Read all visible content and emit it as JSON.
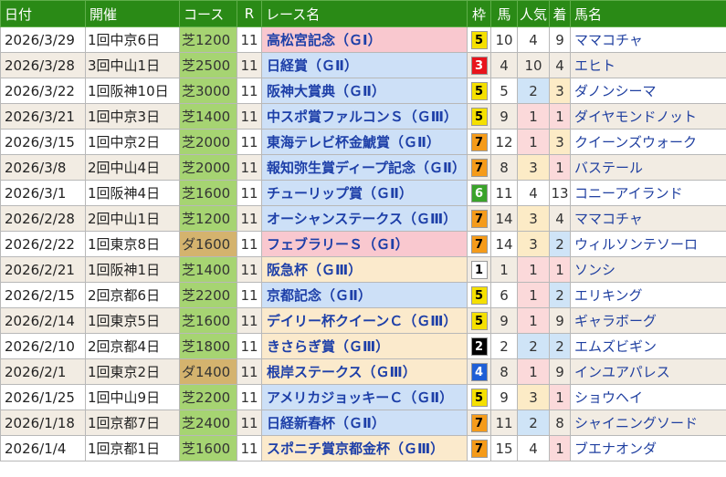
{
  "headers": [
    "日付",
    "開催",
    "コース",
    "R",
    "レース名",
    "枠",
    "馬",
    "人気",
    "着",
    "馬名"
  ],
  "frame_colors": {
    "1": {
      "bg": "#ffffff",
      "fg": "#000000"
    },
    "2": {
      "bg": "#000000",
      "fg": "#ffffff"
    },
    "3": {
      "bg": "#e8141c",
      "fg": "#ffffff"
    },
    "4": {
      "bg": "#1f5fd6",
      "fg": "#ffffff"
    },
    "5": {
      "bg": "#f5e000",
      "fg": "#000000"
    },
    "6": {
      "bg": "#3aa32a",
      "fg": "#ffffff"
    },
    "7": {
      "bg": "#f59b1a",
      "fg": "#000000"
    },
    "8": {
      "bg": "#f49ab5",
      "fg": "#000000"
    }
  },
  "rows": [
    {
      "date": "2026/3/29",
      "track": "1回中京6日",
      "surface": "turf",
      "course": "芝1200",
      "r": "11",
      "race": "高松宮記念（ＧⅠ）",
      "grade": "g1",
      "frame": "5",
      "horse_no": "10",
      "pop": "4",
      "finish": "9",
      "horse": "ママコチャ"
    },
    {
      "date": "2026/3/28",
      "track": "3回中山1日",
      "surface": "turf",
      "course": "芝2500",
      "r": "11",
      "race": "日経賞（ＧⅡ）",
      "grade": "g2",
      "frame": "3",
      "horse_no": "4",
      "pop": "10",
      "finish": "4",
      "horse": "エヒト"
    },
    {
      "date": "2026/3/22",
      "track": "1回阪神10日",
      "surface": "turf",
      "course": "芝3000",
      "r": "11",
      "race": "阪神大賞典（ＧⅡ）",
      "grade": "g2",
      "frame": "5",
      "horse_no": "5",
      "pop": "2",
      "finish": "3",
      "horse": "ダノンシーマ"
    },
    {
      "date": "2026/3/21",
      "track": "1回中京3日",
      "surface": "turf",
      "course": "芝1400",
      "r": "11",
      "race": "中スポ賞ファルコンＳ（ＧⅢ）",
      "grade": "g2",
      "frame": "5",
      "horse_no": "9",
      "pop": "1",
      "finish": "1",
      "horse": "ダイヤモンドノット"
    },
    {
      "date": "2026/3/15",
      "track": "1回中京2日",
      "surface": "turf",
      "course": "芝2000",
      "r": "11",
      "race": "東海テレビ杯金鯱賞（ＧⅡ）",
      "grade": "g2",
      "frame": "7",
      "horse_no": "12",
      "pop": "1",
      "finish": "3",
      "horse": "クイーンズウォーク"
    },
    {
      "date": "2026/3/8",
      "track": "2回中山4日",
      "surface": "turf",
      "course": "芝2000",
      "r": "11",
      "race": "報知弥生賞ディープ記念（ＧⅡ）",
      "grade": "g2",
      "frame": "7",
      "horse_no": "8",
      "pop": "3",
      "finish": "1",
      "horse": "バステール"
    },
    {
      "date": "2026/3/1",
      "track": "1回阪神4日",
      "surface": "turf",
      "course": "芝1600",
      "r": "11",
      "race": "チューリップ賞（ＧⅡ）",
      "grade": "g2",
      "frame": "6",
      "horse_no": "11",
      "pop": "4",
      "finish": "13",
      "horse": "コニーアイランド"
    },
    {
      "date": "2026/2/28",
      "track": "2回中山1日",
      "surface": "turf",
      "course": "芝1200",
      "r": "11",
      "race": "オーシャンステークス（ＧⅢ）",
      "grade": "g2",
      "frame": "7",
      "horse_no": "14",
      "pop": "3",
      "finish": "4",
      "horse": "ママコチャ"
    },
    {
      "date": "2026/2/22",
      "track": "1回東京8日",
      "surface": "dirt",
      "course": "ダ1600",
      "r": "11",
      "race": "フェブラリーＳ（ＧⅠ）",
      "grade": "g1",
      "frame": "7",
      "horse_no": "14",
      "pop": "3",
      "finish": "2",
      "horse": "ウィルソンテソーロ"
    },
    {
      "date": "2026/2/21",
      "track": "1回阪神1日",
      "surface": "turf",
      "course": "芝1400",
      "r": "11",
      "race": "阪急杯（ＧⅢ）",
      "grade": "g3",
      "frame": "1",
      "horse_no": "1",
      "pop": "1",
      "finish": "1",
      "horse": "ソンシ"
    },
    {
      "date": "2026/2/15",
      "track": "2回京都6日",
      "surface": "turf",
      "course": "芝2200",
      "r": "11",
      "race": "京都記念（ＧⅡ）",
      "grade": "g2",
      "frame": "5",
      "horse_no": "6",
      "pop": "1",
      "finish": "2",
      "horse": "エリキング"
    },
    {
      "date": "2026/2/14",
      "track": "1回東京5日",
      "surface": "turf",
      "course": "芝1600",
      "r": "11",
      "race": "デイリー杯クイーンＣ（ＧⅢ）",
      "grade": "g3",
      "frame": "5",
      "horse_no": "9",
      "pop": "1",
      "finish": "9",
      "horse": "ギャラボーグ"
    },
    {
      "date": "2026/2/10",
      "track": "2回京都4日",
      "surface": "turf",
      "course": "芝1800",
      "r": "11",
      "race": "きさらぎ賞（ＧⅢ）",
      "grade": "g3",
      "frame": "2",
      "horse_no": "2",
      "pop": "2",
      "finish": "2",
      "horse": "エムズビギン"
    },
    {
      "date": "2026/2/1",
      "track": "1回東京2日",
      "surface": "dirt",
      "course": "ダ1400",
      "r": "11",
      "race": "根岸ステークス（ＧⅢ）",
      "grade": "g3",
      "frame": "4",
      "horse_no": "8",
      "pop": "1",
      "finish": "9",
      "horse": "インユアパレス"
    },
    {
      "date": "2026/1/25",
      "track": "1回中山9日",
      "surface": "turf",
      "course": "芝2200",
      "r": "11",
      "race": "アメリカジョッキーＣ（ＧⅡ）",
      "grade": "g2",
      "frame": "5",
      "horse_no": "9",
      "pop": "3",
      "finish": "1",
      "horse": "ショウヘイ"
    },
    {
      "date": "2026/1/18",
      "track": "1回京都7日",
      "surface": "turf",
      "course": "芝2400",
      "r": "11",
      "race": "日経新春杯（ＧⅡ）",
      "grade": "g2",
      "frame": "7",
      "horse_no": "11",
      "pop": "2",
      "finish": "8",
      "horse": "シャイニングソード"
    },
    {
      "date": "2026/1/4",
      "track": "1回京都1日",
      "surface": "turf",
      "course": "芝1600",
      "r": "11",
      "race": "スポニチ賞京都金杯（ＧⅢ）",
      "grade": "g3",
      "frame": "7",
      "horse_no": "15",
      "pop": "4",
      "finish": "1",
      "horse": "ブエナオンダ"
    }
  ]
}
